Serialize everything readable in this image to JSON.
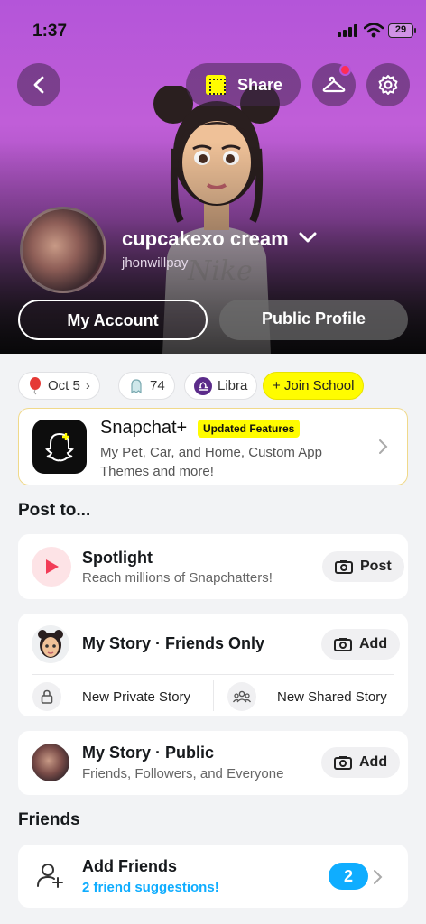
{
  "status_bar": {
    "time": "1:37",
    "battery": "29"
  },
  "header": {
    "share_label": "Share",
    "icons": [
      "back-arrow-icon",
      "qr-code-icon",
      "hanger-icon",
      "gear-icon"
    ],
    "notification_color": "#ff2d55"
  },
  "profile": {
    "display_name": "cupcakexo cream",
    "username": "jhonwillpay",
    "my_account_label": "My Account",
    "public_profile_label": "Public Profile"
  },
  "chips": {
    "birthday": "Oct 5",
    "friend_count": "74",
    "zodiac": "Libra",
    "join_school": "+ Join School"
  },
  "snapchat_plus": {
    "title": "Snapchat+",
    "badge": "Updated Features",
    "description": "My Pet, Car, and Home, Custom App Themes and more!",
    "accent": "#fffc00"
  },
  "post_to": {
    "heading": "Post to...",
    "spotlight": {
      "title": "Spotlight",
      "subtitle": "Reach millions of Snapchatters!",
      "button": "Post"
    },
    "my_story_friends": {
      "title": "My Story · Friends Only",
      "button": "Add"
    },
    "new_private_story": "New Private Story",
    "new_shared_story": "New Shared Story",
    "my_story_public": {
      "title": "My Story · Public",
      "subtitle": "Friends, Followers, and Everyone",
      "button": "Add"
    }
  },
  "friends": {
    "heading": "Friends",
    "add_friends_title": "Add Friends",
    "suggestions": "2 friend suggestions!",
    "count": "2",
    "badge_color": "#0fadff"
  }
}
